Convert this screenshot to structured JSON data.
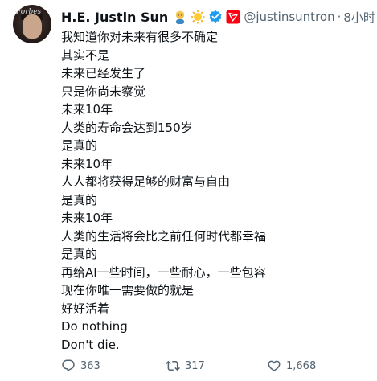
{
  "author": {
    "name": "H.E. Justin Sun",
    "handle": "@justinsuntron",
    "separator": "·",
    "time": "8小时",
    "avatar_text": "Forbes",
    "badges": [
      "person-emoji-icon",
      "sun-emoji-icon",
      "verified-badge-icon",
      "tron-logo-icon"
    ]
  },
  "tweet": {
    "lines": [
      "我知道你对未来有很多不确定",
      "其实不是",
      "未来已经发生了",
      "只是你尚未察觉",
      "未来10年",
      "人类的寿命会达到150岁",
      "是真的",
      "未来10年",
      "人人都将获得足够的财富与自由",
      "是真的",
      "未来10年",
      "人类的生活将会比之前任何时代都幸福",
      "是真的",
      "再给AI一些时间，一些耐心，一些包容",
      "现在你唯一需要做的就是",
      "好好活着",
      "Do nothing",
      "Don't die."
    ]
  },
  "actions": {
    "replies": "363",
    "reposts": "317",
    "likes": "1,668"
  },
  "colors": {
    "text": "#0f1419",
    "secondary": "#536471",
    "verified": "#1d9bf0",
    "tron": "#ff0013"
  }
}
